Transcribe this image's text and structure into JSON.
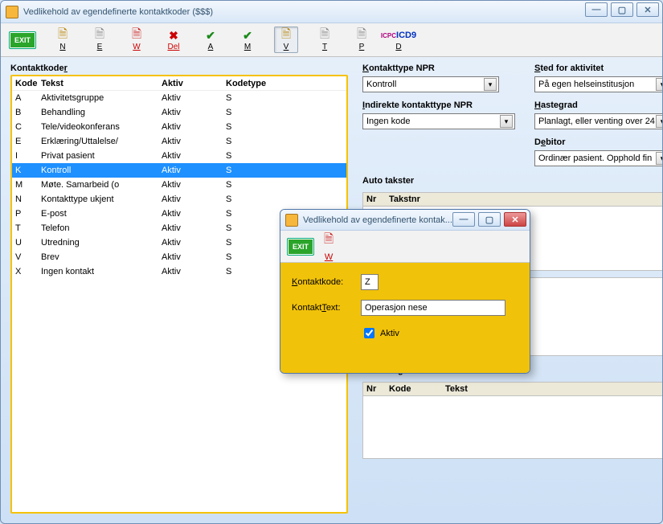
{
  "window": {
    "title": "Vedlikehold av egendefinerte kontaktkoder ($$$)",
    "buttons": {
      "min": "—",
      "max": "▢",
      "close": "✕"
    }
  },
  "toolbar": {
    "exit": "EXIT",
    "items": [
      {
        "key": "N",
        "label": "N"
      },
      {
        "key": "E",
        "label": "E"
      },
      {
        "key": "W",
        "label": "W"
      },
      {
        "key": "Del",
        "label": "Del"
      },
      {
        "key": "A",
        "label": "A"
      },
      {
        "key": "M",
        "label": "M"
      },
      {
        "key": "V",
        "label": "V"
      },
      {
        "key": "T",
        "label": "T"
      },
      {
        "key": "P",
        "label": "P"
      },
      {
        "key": "D",
        "label": "D"
      }
    ]
  },
  "left": {
    "title": "Kontaktkoder",
    "columns": {
      "kode": "Kode",
      "tekst": "Tekst",
      "aktiv": "Aktiv",
      "kodetype": "Kodetype"
    },
    "rows": [
      {
        "kode": "A",
        "tekst": "Aktivitetsgruppe",
        "aktiv": "Aktiv",
        "kodetype": "S",
        "sel": false
      },
      {
        "kode": "B",
        "tekst": "Behandling",
        "aktiv": "Aktiv",
        "kodetype": "S",
        "sel": false
      },
      {
        "kode": "C",
        "tekst": "Tele/videokonferans",
        "aktiv": "Aktiv",
        "kodetype": "S",
        "sel": false
      },
      {
        "kode": "E",
        "tekst": "Erklæring/Uttalelse/",
        "aktiv": "Aktiv",
        "kodetype": "S",
        "sel": false
      },
      {
        "kode": "I",
        "tekst": "Privat pasient",
        "aktiv": "Aktiv",
        "kodetype": "S",
        "sel": false
      },
      {
        "kode": "K",
        "tekst": "Kontroll",
        "aktiv": "Aktiv",
        "kodetype": "S",
        "sel": true
      },
      {
        "kode": "M",
        "tekst": "Møte. Samarbeid (o",
        "aktiv": "Aktiv",
        "kodetype": "S",
        "sel": false
      },
      {
        "kode": "N",
        "tekst": "Kontakttype ukjent",
        "aktiv": "Aktiv",
        "kodetype": "S",
        "sel": false
      },
      {
        "kode": "P",
        "tekst": "E-post",
        "aktiv": "Aktiv",
        "kodetype": "S",
        "sel": false
      },
      {
        "kode": "T",
        "tekst": "Telefon",
        "aktiv": "Aktiv",
        "kodetype": "S",
        "sel": false
      },
      {
        "kode": "U",
        "tekst": "Utredning",
        "aktiv": "Aktiv",
        "kodetype": "S",
        "sel": false
      },
      {
        "kode": "V",
        "tekst": "Brev",
        "aktiv": "Aktiv",
        "kodetype": "S",
        "sel": false
      },
      {
        "kode": "X",
        "tekst": "Ingen kontakt",
        "aktiv": "Aktiv",
        "kodetype": "S",
        "sel": false
      }
    ]
  },
  "right": {
    "fields": {
      "kontakttype_npr": {
        "label": "Kontakttype NPR",
        "value": "Kontroll"
      },
      "sted_for_aktivitet": {
        "label": "Sted for aktivitet",
        "value": "På egen helseinstitusjon"
      },
      "indirekte_kontakttype_npr": {
        "label": "Indirekte kontakttype NPR",
        "value": "Ingen kode"
      },
      "hastegrad": {
        "label": "Hastegrad",
        "value": "Planlagt, eller venting over 24"
      },
      "debitor": {
        "label": "Debitor",
        "value": "Ordinær pasient. Opphold fin"
      }
    },
    "panels": {
      "auto_takster": {
        "title": "Auto takster",
        "cols": {
          "nr": "Nr",
          "takstnr": "Takstnr"
        }
      },
      "auto_diagnoser": {
        "title": "Auto diagnoser",
        "cols": {
          "nr": "Nr",
          "kode": "Kode",
          "tekst": "Tekst"
        }
      }
    }
  },
  "modal": {
    "title": "Vedlikehold av egendefinerte kontak...",
    "buttons": {
      "min": "—",
      "max": "▢",
      "close": "✕"
    },
    "toolbar": {
      "exit": "EXIT",
      "w": "W"
    },
    "form": {
      "kontaktkode_label": "Kontaktkode:",
      "kontaktkode_value": "Z",
      "kontakttext_label": "KontaktText:",
      "kontakttext_value": "Operasjon nese",
      "aktiv_label": "Aktiv",
      "aktiv_checked": true
    }
  }
}
